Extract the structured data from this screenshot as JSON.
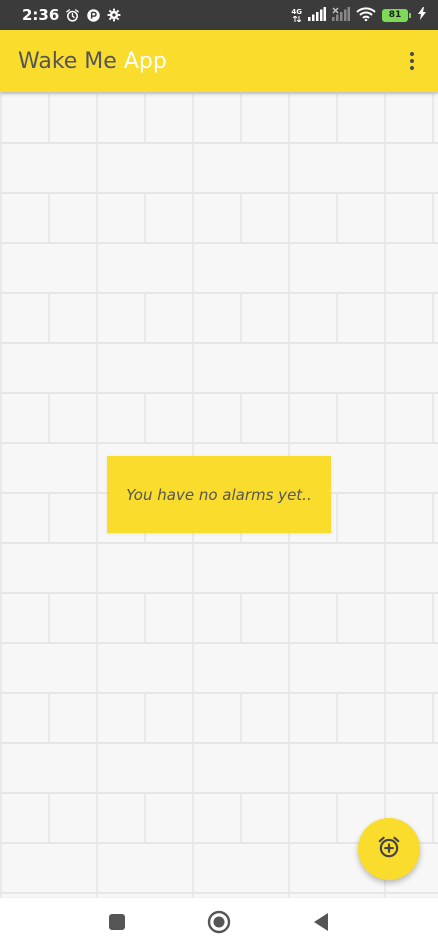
{
  "status_bar": {
    "time": "2:36",
    "network_type": "4G",
    "battery_level": "81",
    "icons": [
      "alarm-icon",
      "app-icon",
      "settings-icon",
      "signal-icon",
      "signal-x-icon",
      "wifi-icon",
      "battery-icon",
      "charging-icon"
    ]
  },
  "app_bar": {
    "title_part1": "Wake Me",
    "title_part2": "App",
    "menu_icon": "more-vert-icon"
  },
  "main": {
    "empty_message": "You have no alarms yet.."
  },
  "fab": {
    "icon": "add-alarm-icon"
  },
  "nav_bar": {
    "icons": [
      "recents-square-icon",
      "home-circle-icon",
      "back-triangle-icon"
    ]
  },
  "colors": {
    "accent": "#f9dc2c",
    "status_bar": "#3b3b3b",
    "title_text": "#555555",
    "battery": "#7ed957"
  }
}
